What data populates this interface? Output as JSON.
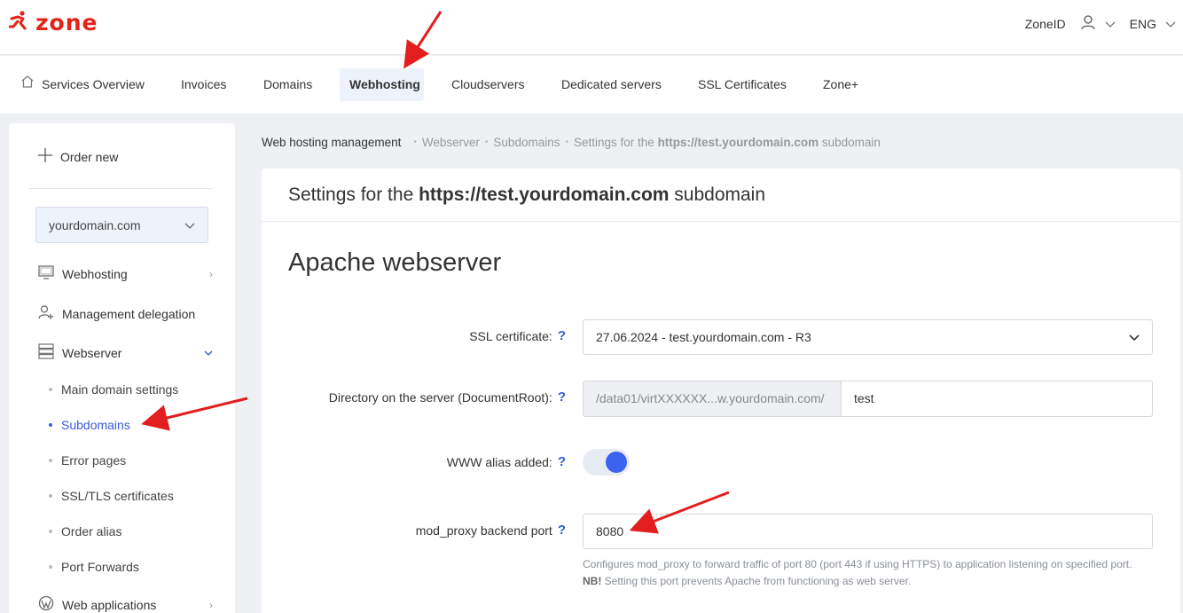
{
  "header": {
    "logo_text": "zone",
    "zoneid_label": "ZoneID",
    "language": "ENG"
  },
  "nav": {
    "items": [
      {
        "label": "Services Overview"
      },
      {
        "label": "Invoices"
      },
      {
        "label": "Domains"
      },
      {
        "label": "Webhosting"
      },
      {
        "label": "Cloudservers"
      },
      {
        "label": "Dedicated servers"
      },
      {
        "label": "SSL Certificates"
      },
      {
        "label": "Zone+"
      }
    ],
    "active": "Webhosting"
  },
  "sidebar": {
    "order_new": "Order new",
    "domain_select": "yourdomain.com",
    "items": [
      {
        "label": "Webhosting",
        "icon": "monitor-icon"
      },
      {
        "label": "Management delegation",
        "icon": "user-plus-icon"
      },
      {
        "label": "Webserver",
        "icon": "server-icon"
      },
      {
        "label": "Web applications",
        "icon": "wordpress-icon"
      }
    ],
    "subitems": [
      {
        "label": "Main domain settings"
      },
      {
        "label": "Subdomains"
      },
      {
        "label": "Error pages"
      },
      {
        "label": "SSL/TLS certificates"
      },
      {
        "label": "Order alias"
      },
      {
        "label": "Port Forwards"
      }
    ]
  },
  "breadcrumb": {
    "root": "Web hosting management",
    "crumb1": "Webserver",
    "crumb2": "Subdomains",
    "crumb3_prefix": "Settings for the ",
    "crumb3_strong": "https://test.yourdomain.com",
    "crumb3_suffix": " subdomain"
  },
  "card": {
    "title_prefix": "Settings for the ",
    "title_strong": "https://test.yourdomain.com",
    "title_suffix": " subdomain",
    "section_title": "Apache webserver"
  },
  "form": {
    "ssl_label": "SSL certificate:",
    "ssl_value": "27.06.2024 - test.yourdomain.com - R3",
    "dir_label": "Directory on the server (DocumentRoot):",
    "dir_prefix": "/data01/virtXXXXXX...w.yourdomain.com/",
    "dir_value": "test",
    "www_label": "WWW alias added:",
    "www_enabled": true,
    "proxy_label": "mod_proxy backend port",
    "proxy_value": "8080",
    "help_text_1": "Configures mod_proxy to forward traffic of port 80 (port 443 if using HTTPS) to application listening on specified port. ",
    "help_text_nb": "NB!",
    "help_text_2": " Setting this port prevents Apache from functioning as web server.",
    "help_mark": "?"
  },
  "colors": {
    "brand": "#e2231a",
    "accent": "#3b63f0",
    "link": "#3b5bdb",
    "arrow": "#e31e1e"
  }
}
